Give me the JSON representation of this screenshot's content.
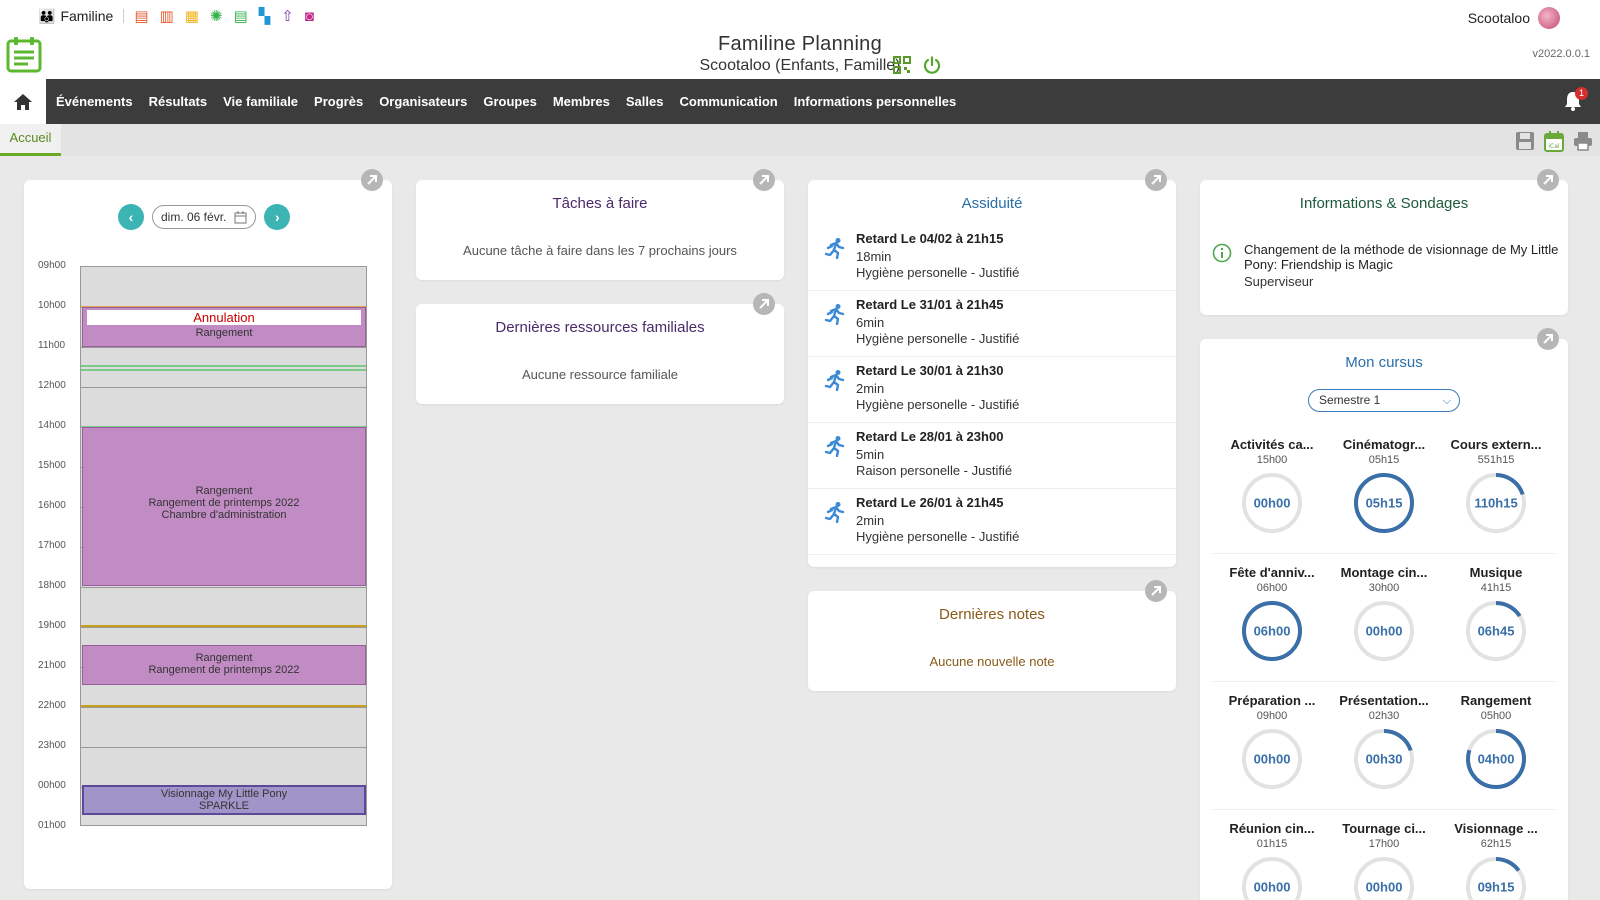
{
  "topbar": {
    "brand": "Familine",
    "user": "Scootaloo",
    "app_icons": [
      {
        "name": "document-icon",
        "glyph": "▤",
        "color": "#e8572b"
      },
      {
        "name": "book-icon",
        "glyph": "▥",
        "color": "#e8572b"
      },
      {
        "name": "library-icon",
        "glyph": "▦",
        "color": "#f2b21a"
      },
      {
        "name": "atom-icon",
        "glyph": "✺",
        "color": "#35b34a"
      },
      {
        "name": "list-icon",
        "glyph": "▤",
        "color": "#35b34a"
      },
      {
        "name": "sitemap-icon",
        "glyph": "▚",
        "color": "#1f98d5"
      },
      {
        "name": "upload-icon",
        "glyph": "⇧",
        "color": "#7a3aa6"
      },
      {
        "name": "contact-icon",
        "glyph": "◙",
        "color": "#c4298c"
      }
    ]
  },
  "header": {
    "title": "Familine Planning",
    "subtitle": "Scootaloo (Enfants, Famille)",
    "version": "v2022.0.0.1"
  },
  "nav": {
    "items": [
      "Événements",
      "Résultats",
      "Vie familiale",
      "Progrès",
      "Organisateurs",
      "Groupes",
      "Membres",
      "Salles",
      "Communication",
      "Informations personnelles"
    ],
    "notification_count": "1"
  },
  "tabs": {
    "active": "Accueil"
  },
  "calendar": {
    "date": "dim. 06 févr.",
    "hours": [
      "09h00",
      "10h00",
      "11h00",
      "12h00",
      "14h00",
      "15h00",
      "16h00",
      "17h00",
      "18h00",
      "19h00",
      "21h00",
      "22h00",
      "23h00",
      "00h00",
      "01h00"
    ],
    "events": [
      {
        "status": "Annulation",
        "lines": [
          "Rangement"
        ]
      },
      {
        "lines": [
          "Rangement",
          "Rangement de printemps 2022",
          "Chambre d'administration"
        ]
      },
      {
        "lines": [
          "Rangement",
          "Rangement de printemps 2022"
        ]
      },
      {
        "lines": [
          "Visionnage My Little Pony",
          "SPARKLE"
        ]
      }
    ]
  },
  "tasks": {
    "title": "Tâches à faire",
    "empty": "Aucune tâche à faire dans les 7 prochains jours"
  },
  "resources": {
    "title": "Dernières ressources familiales",
    "empty": "Aucune ressource familiale"
  },
  "attendance": {
    "title": "Assiduité",
    "items": [
      {
        "title": "Retard Le 04/02 à 21h15",
        "duration": "18min",
        "reason": "Hygiène personelle - Justifié"
      },
      {
        "title": "Retard Le 31/01 à 21h45",
        "duration": "6min",
        "reason": "Hygiène personelle - Justifié"
      },
      {
        "title": "Retard Le 30/01 à 21h30",
        "duration": "2min",
        "reason": "Hygiène personelle - Justifié"
      },
      {
        "title": "Retard Le 28/01 à 23h00",
        "duration": "5min",
        "reason": "Raison personelle - Justifié"
      },
      {
        "title": "Retard Le 26/01 à 21h45",
        "duration": "2min",
        "reason": "Hygiène personelle - Justifié"
      }
    ]
  },
  "notes": {
    "title": "Dernières notes",
    "empty": "Aucune nouvelle note"
  },
  "info": {
    "title": "Informations & Sondages",
    "message": "Changement de la méthode de visionnage de My Little Pony: Friendship is Magic",
    "author": "Superviseur"
  },
  "cursus": {
    "title": "Mon cursus",
    "semester": "Semestre 1",
    "items": [
      {
        "name": "Activités ca...",
        "total": "15h00",
        "done": "00h00",
        "progress": 0
      },
      {
        "name": "Cinématogr...",
        "total": "05h15",
        "done": "05h15",
        "progress": 1
      },
      {
        "name": "Cours extern...",
        "total": "551h15",
        "done": "110h15",
        "progress": 0.2
      },
      {
        "name": "Fête d'anniv...",
        "total": "06h00",
        "done": "06h00",
        "progress": 1
      },
      {
        "name": "Montage cin...",
        "total": "30h00",
        "done": "00h00",
        "progress": 0
      },
      {
        "name": "Musique",
        "total": "41h15",
        "done": "06h45",
        "progress": 0.16
      },
      {
        "name": "Préparation ...",
        "total": "09h00",
        "done": "00h00",
        "progress": 0
      },
      {
        "name": "Présentation...",
        "total": "02h30",
        "done": "00h30",
        "progress": 0.2
      },
      {
        "name": "Rangement",
        "total": "05h00",
        "done": "04h00",
        "progress": 0.8
      },
      {
        "name": "Réunion cin...",
        "total": "01h15",
        "done": "00h00",
        "progress": 0
      },
      {
        "name": "Tournage ci...",
        "total": "17h00",
        "done": "00h00",
        "progress": 0
      },
      {
        "name": "Visionnage ...",
        "total": "62h15",
        "done": "09h15",
        "progress": 0.15
      }
    ]
  },
  "colors": {
    "nav_bg": "#3c3c3c",
    "accent_green": "#6aaa25",
    "teal": "#3db4b4",
    "tasks_title": "#4a2a6a",
    "attendance_title": "#2a6fa8",
    "notes_title": "#8a5a1a",
    "info_title": "#1d5a3a",
    "cursus_title": "#2a6fa8",
    "ring_fill": "#3a6fa8",
    "ring_track": "#e2e2e2",
    "event_purple": "#c18cc4",
    "event_blue": "#a194c8"
  }
}
